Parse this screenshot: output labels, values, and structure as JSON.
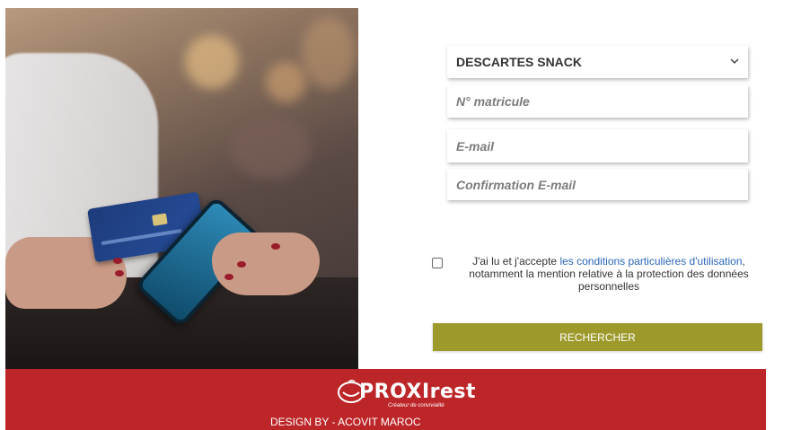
{
  "form": {
    "restaurant_select": {
      "selected": "DESCARTES SNACK"
    },
    "matricule": {
      "placeholder": "N° matricule"
    },
    "email": {
      "placeholder": "E-mail"
    },
    "email_confirm": {
      "placeholder": "Confirmation E-mail"
    },
    "consent": {
      "before_link": "J'ai lu et j'accepte ",
      "link": "les conditions particulières d'utilisation",
      "after_link": ", notamment la mention relative à la protection des données personnelles"
    },
    "submit_label": "RECHERCHER"
  },
  "footer": {
    "brand": "PROXIrest",
    "tagline": "Créateur de convivialité",
    "credit": "DESIGN BY - ACOVIT MAROC"
  },
  "colors": {
    "footer_bg": "#bd2629",
    "button_bg": "#9d9a2b",
    "link": "#2a65b7"
  }
}
